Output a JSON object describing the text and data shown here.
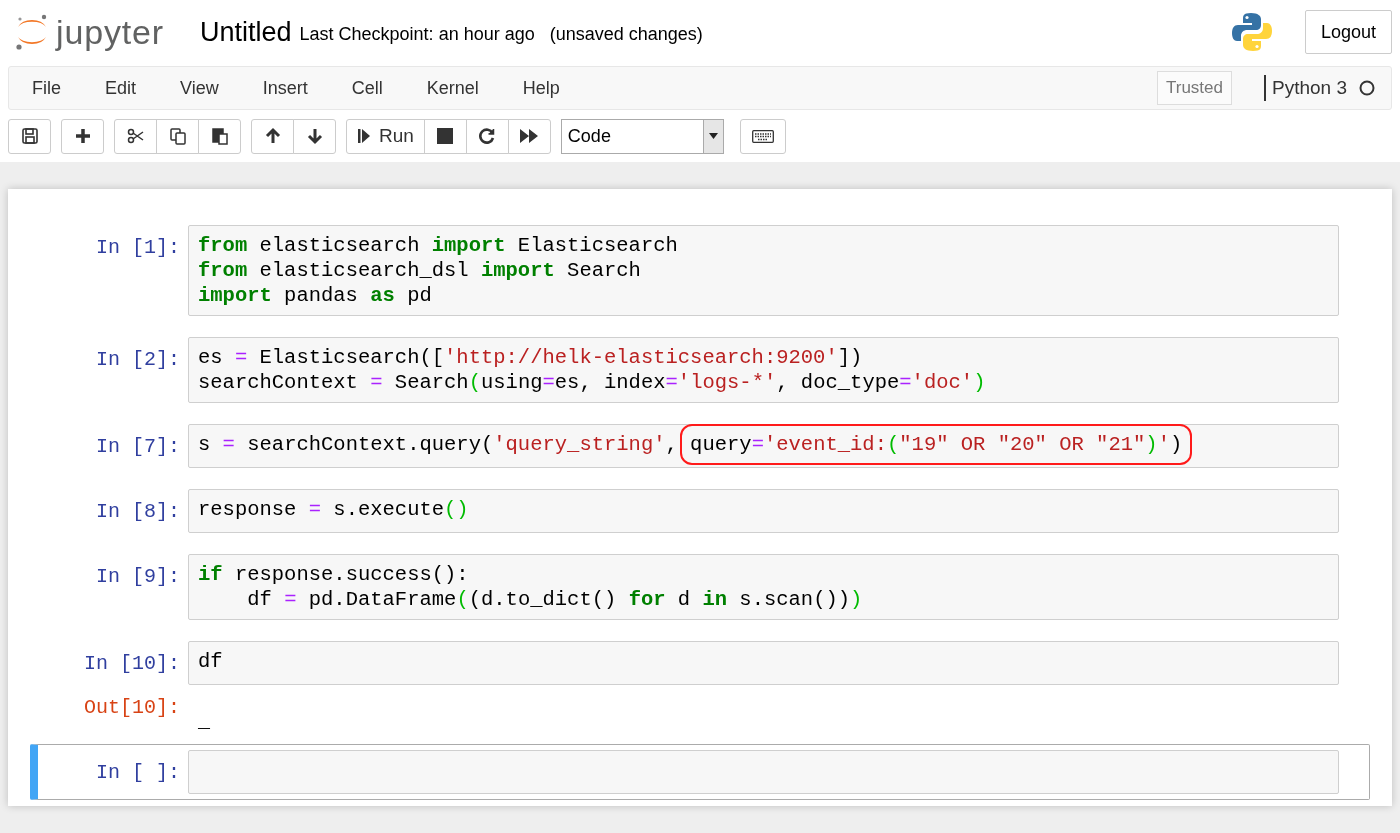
{
  "header": {
    "logo_text": "jupyter",
    "title": "Untitled",
    "checkpoint": "Last Checkpoint: an hour ago",
    "save_status": "(unsaved changes)",
    "logout": "Logout"
  },
  "menu": {
    "items": [
      "File",
      "Edit",
      "View",
      "Insert",
      "Cell",
      "Kernel",
      "Help"
    ],
    "trusted": "Trusted",
    "kernel": "Python 3",
    "kernel_busy": false
  },
  "toolbar": {
    "groups": [
      [
        {
          "kind": "save"
        }
      ],
      [
        {
          "kind": "plus"
        }
      ],
      [
        {
          "kind": "cut"
        },
        {
          "kind": "copy"
        },
        {
          "kind": "paste"
        }
      ],
      [
        {
          "kind": "up"
        },
        {
          "kind": "down"
        }
      ],
      [
        {
          "kind": "run",
          "label": "Run"
        },
        {
          "kind": "stop"
        },
        {
          "kind": "restart"
        },
        {
          "kind": "fastforward"
        }
      ]
    ],
    "cell_type": "Code"
  },
  "cells": [
    {
      "prompt": "In [1]:",
      "selected": false,
      "lines": [
        [
          {
            "circled": false,
            "tokens": [
              {
                "kind": "kw",
                "text": "from"
              },
              {
                "kind": "plain",
                "text": " elasticsearch "
              },
              {
                "kind": "kw",
                "text": "import"
              },
              {
                "kind": "plain",
                "text": " Elasticsearch"
              }
            ]
          }
        ],
        [
          {
            "circled": false,
            "tokens": [
              {
                "kind": "kw",
                "text": "from"
              },
              {
                "kind": "plain",
                "text": " elasticsearch_dsl "
              },
              {
                "kind": "kw",
                "text": "import"
              },
              {
                "kind": "plain",
                "text": " Search"
              }
            ]
          }
        ],
        [
          {
            "circled": false,
            "tokens": [
              {
                "kind": "kw",
                "text": "import"
              },
              {
                "kind": "plain",
                "text": " pandas "
              },
              {
                "kind": "kw",
                "text": "as"
              },
              {
                "kind": "plain",
                "text": " pd"
              }
            ]
          }
        ]
      ]
    },
    {
      "prompt": "In [2]:",
      "selected": false,
      "lines": [
        [
          {
            "circled": false,
            "tokens": [
              {
                "kind": "plain",
                "text": "es "
              },
              {
                "kind": "op",
                "text": "="
              },
              {
                "kind": "plain",
                "text": " Elasticsearch(["
              },
              {
                "kind": "str",
                "text": "'http://helk-elasticsearch:9200'"
              },
              {
                "kind": "plain",
                "text": "])"
              }
            ]
          }
        ],
        [
          {
            "circled": false,
            "tokens": [
              {
                "kind": "plain",
                "text": "searchContext "
              },
              {
                "kind": "op",
                "text": "="
              },
              {
                "kind": "plain",
                "text": " Search"
              },
              {
                "kind": "paren",
                "text": "("
              },
              {
                "kind": "plain",
                "text": "using"
              },
              {
                "kind": "op",
                "text": "="
              },
              {
                "kind": "plain",
                "text": "es, index"
              },
              {
                "kind": "op",
                "text": "="
              },
              {
                "kind": "str",
                "text": "'logs-*'"
              },
              {
                "kind": "plain",
                "text": ", doc_type"
              },
              {
                "kind": "op",
                "text": "="
              },
              {
                "kind": "str",
                "text": "'doc'"
              },
              {
                "kind": "paren",
                "text": ")"
              }
            ]
          }
        ]
      ]
    },
    {
      "prompt": "In [7]:",
      "selected": false,
      "lines": [
        [
          {
            "circled": false,
            "tokens": [
              {
                "kind": "plain",
                "text": "s "
              },
              {
                "kind": "op",
                "text": "="
              },
              {
                "kind": "plain",
                "text": " searchContext.query("
              },
              {
                "kind": "str",
                "text": "'query_string'"
              },
              {
                "kind": "plain",
                "text": ", "
              }
            ]
          },
          {
            "circled": true,
            "tokens": [
              {
                "kind": "plain",
                "text": "query"
              },
              {
                "kind": "op",
                "text": "="
              },
              {
                "kind": "str",
                "text": "'event_id:"
              },
              {
                "kind": "paren",
                "text": "("
              },
              {
                "kind": "str",
                "text": "\"19\" OR \"20\" OR \"21\""
              },
              {
                "kind": "paren",
                "text": ")"
              },
              {
                "kind": "str",
                "text": "'"
              },
              {
                "kind": "plain",
                "text": ")"
              }
            ]
          }
        ]
      ]
    },
    {
      "prompt": "In [8]:",
      "selected": false,
      "lines": [
        [
          {
            "circled": false,
            "tokens": [
              {
                "kind": "plain",
                "text": "response "
              },
              {
                "kind": "op",
                "text": "="
              },
              {
                "kind": "plain",
                "text": " s.execute"
              },
              {
                "kind": "paren",
                "text": "()"
              }
            ]
          }
        ]
      ]
    },
    {
      "prompt": "In [9]:",
      "selected": false,
      "lines": [
        [
          {
            "circled": false,
            "tokens": [
              {
                "kind": "kw",
                "text": "if"
              },
              {
                "kind": "plain",
                "text": " response.success():"
              }
            ]
          }
        ],
        [
          {
            "circled": false,
            "tokens": [
              {
                "kind": "plain",
                "text": "    df "
              },
              {
                "kind": "op",
                "text": "="
              },
              {
                "kind": "plain",
                "text": " pd.DataFrame"
              },
              {
                "kind": "paren",
                "text": "("
              },
              {
                "kind": "plain",
                "text": "(d.to_dict() "
              },
              {
                "kind": "kw",
                "text": "for"
              },
              {
                "kind": "plain",
                "text": " d "
              },
              {
                "kind": "kw",
                "text": "in"
              },
              {
                "kind": "plain",
                "text": " s.scan())"
              },
              {
                "kind": "paren",
                "text": ")"
              }
            ]
          }
        ]
      ]
    },
    {
      "prompt": "In [10]:",
      "selected": false,
      "lines": [
        [
          {
            "circled": false,
            "tokens": [
              {
                "kind": "plain",
                "text": "df"
              }
            ]
          }
        ]
      ],
      "output": {
        "prompt": "Out[10]:",
        "text": "_"
      }
    },
    {
      "prompt": "In [ ]:",
      "selected": true
    }
  ]
}
